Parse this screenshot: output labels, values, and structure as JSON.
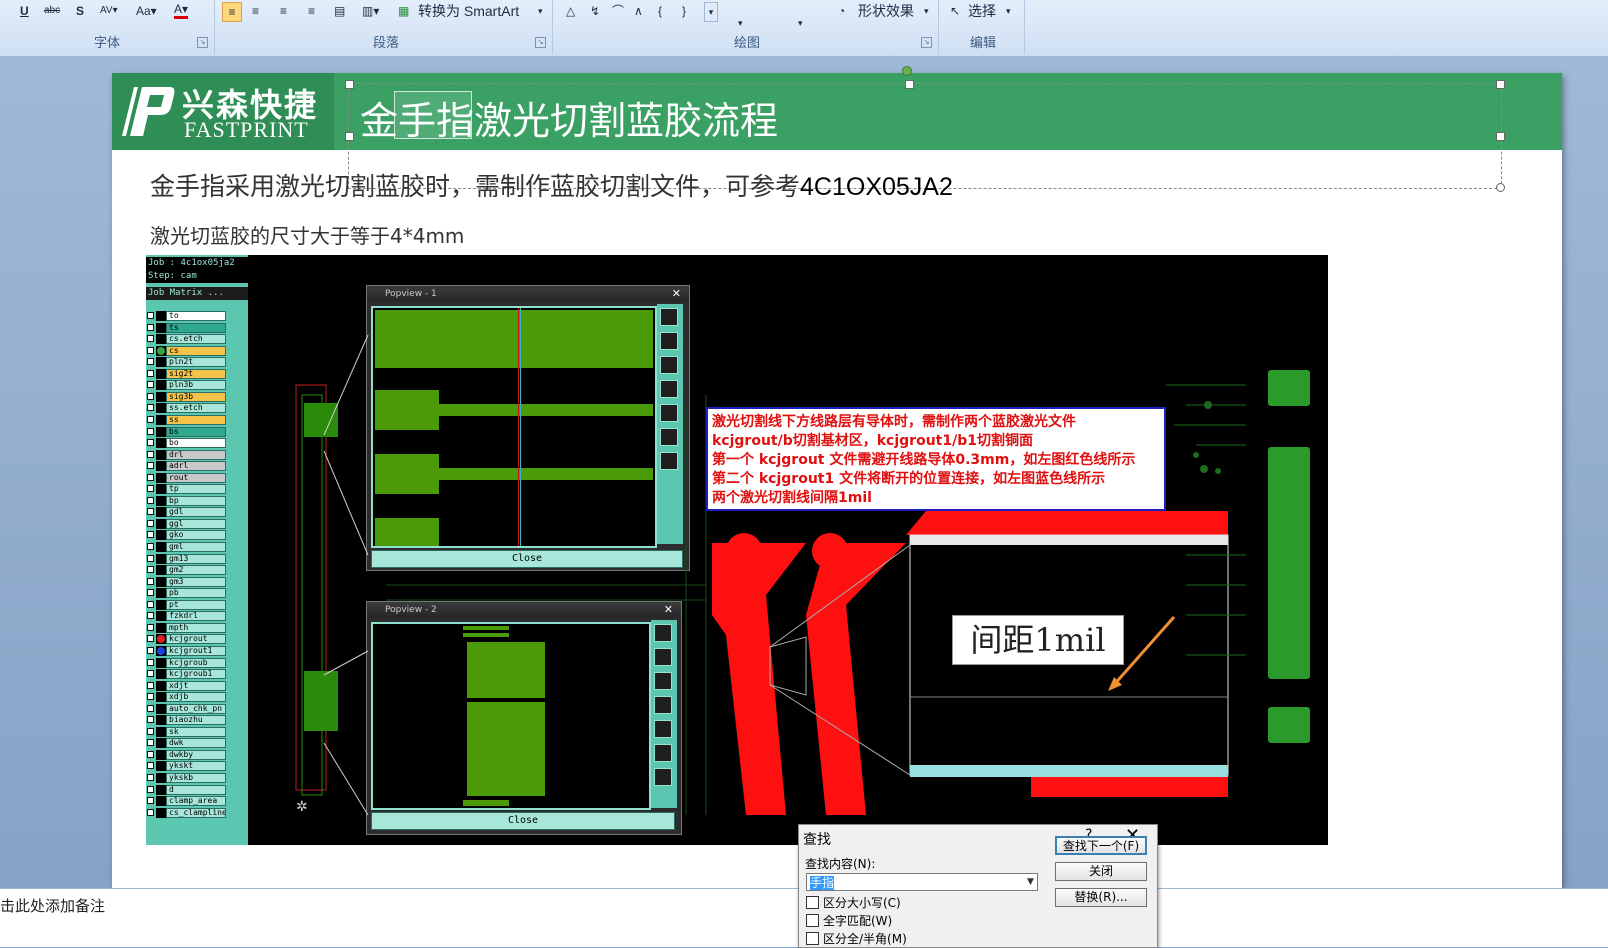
{
  "ribbon": {
    "smartart_label": "转换为 SmartArt",
    "shape_effect_label": "形状效果",
    "select_label": "选择",
    "groups": [
      "字体",
      "段落",
      "绘图",
      "编辑"
    ]
  },
  "slide": {
    "logo_cn": "兴森快捷",
    "logo_en": "FASTPRINT",
    "title": "金手指激光切割蓝胶流程",
    "body_line1": "金手指采用激光切割蓝胶时，需制作蓝胶切割文件，可参考",
    "body_line1_code": "4C1OX05JA2",
    "body_line2": "激光切蓝胶的尺寸大于等于4*4mm"
  },
  "cam": {
    "job": "Job : 4c1ox05ja2",
    "step": "Step: cam",
    "matrix": "Job Matrix ...",
    "layers": [
      "to",
      "ts",
      "cs.etch",
      "cs",
      "pln2t",
      "sig2t",
      "pln3b",
      "sig3b",
      "ss.etch",
      "ss",
      "bs",
      "bo",
      "drl",
      "adrl",
      "rout",
      "tp",
      "bp",
      "gdl",
      "ggl",
      "gko",
      "gml",
      "gm13",
      "gm2",
      "gm3",
      "pb",
      "pt",
      "fzkdrl",
      "mpth",
      "kcjgrout",
      "kcjgrout1",
      "kcjgroub",
      "kcjgroub1",
      "xdjt",
      "xdjb",
      "auto_chk_pn",
      "biaozhu",
      "sk",
      "dwk",
      "dwkby",
      "ykskt",
      "ykskb",
      "d",
      "clamp_area",
      "cs_clampline"
    ],
    "popview1_title": "Popview - 1",
    "popview2_title": "Popview - 2",
    "close_label": "Close",
    "callout_lines": [
      "激光切割线下方线路层有导体时，需制作两个蓝胶激光文件",
      "kcjgrout/b切割基材区，kcjgrout1/b1切割铜面",
      "第一个 kcjgrout 文件需避开线路导体0.3mm，如左图红色线所示",
      "第二个 kcjgrout1 文件将断开的位置连接，如左图蓝色线所示",
      "两个激光切割线间隔1mil"
    ],
    "spacing_label": "间距1mil"
  },
  "notes": {
    "placeholder": "击此处添加备注"
  },
  "find_dialog": {
    "title": "查找",
    "help": "?",
    "close": "✕",
    "label": "查找内容(N):",
    "value": "手指",
    "find_next": "查找下一个(F)",
    "close_btn": "关闭",
    "replace": "替换(R)...",
    "options": [
      "区分大小写(C)",
      "全字匹配(W)",
      "区分全/半角(M)"
    ]
  },
  "colors": {
    "banner": "#3aa064",
    "pcb_green": "#4a9a0a",
    "callout_red": "#e01010",
    "callout_border": "#1f1fbf"
  }
}
